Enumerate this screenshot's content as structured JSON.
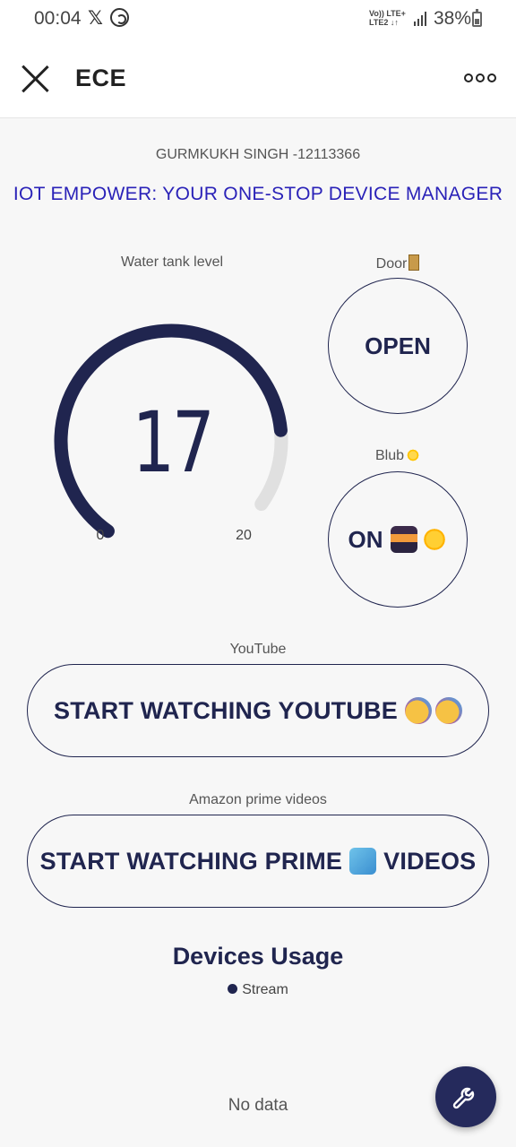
{
  "status_bar": {
    "time": "00:04",
    "x_glyph": "𝕏",
    "network_top": "Vo)) LTE+",
    "network_bottom": "LTE2 ↓↑",
    "battery": "38%",
    "icons": [
      "x-icon",
      "whatsapp-icon",
      "signal-icon",
      "battery-icon"
    ]
  },
  "app_bar": {
    "title": "ECE",
    "close_icon": "close-icon",
    "more_icon": "more-options-icon"
  },
  "header": {
    "subtitle": "GURMKUKH SINGH -12113366",
    "headline": "IOT EMPOWER: YOUR ONE-STOP DEVICE MANAGER",
    "headline_color": "#2a22b8"
  },
  "gauge": {
    "label": "Water tank level",
    "value": "17",
    "min": "0",
    "max": "20",
    "value_num": 17,
    "min_num": 0,
    "max_num": 20,
    "fill_color": "#20254f",
    "track_color": "#e0e0e0"
  },
  "door": {
    "label": "Door",
    "label_icon": "door-emoji",
    "button": "OPEN"
  },
  "bulb": {
    "label": "Blub",
    "label_icon": "sun-emoji",
    "button": "ON",
    "button_icons": [
      "city-sunset-emoji",
      "sun-emoji"
    ]
  },
  "youtube": {
    "label": "YouTube",
    "button": "START WATCHING YOUTUBE",
    "button_icons": [
      "party-face-emoji",
      "party-face-emoji"
    ]
  },
  "prime": {
    "label": "Amazon prime videos",
    "button_before": "START WATCHING PRIME",
    "button_after": "VIDEOS",
    "button_icon": "video-camera-emoji"
  },
  "usage": {
    "title": "Devices Usage",
    "legend": "Stream",
    "empty_text": "No data"
  },
  "fab": {
    "icon": "wrench-icon"
  },
  "colors": {
    "primary": "#20254f",
    "background": "#f7f7f7"
  }
}
